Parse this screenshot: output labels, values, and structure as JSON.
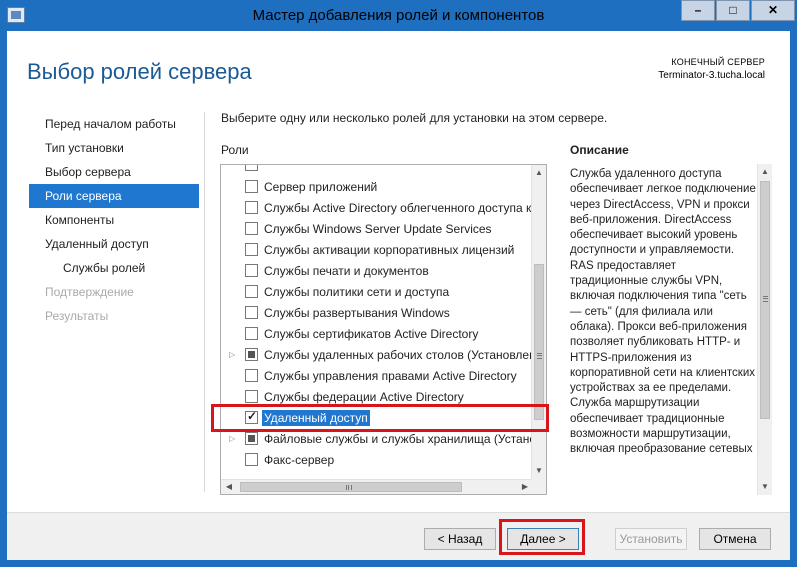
{
  "window": {
    "title": "Мастер добавления ролей и компонентов",
    "controls": {
      "minimize": "–",
      "maximize": "□",
      "close": "✕"
    }
  },
  "header": {
    "page_title": "Выбор ролей сервера",
    "destination_label": "КОНЕЧНЫЙ СЕРВЕР",
    "destination_server": "Terminator-3.tucha.local"
  },
  "nav": {
    "items": [
      {
        "label": "Перед началом работы",
        "state": "normal"
      },
      {
        "label": "Тип установки",
        "state": "normal"
      },
      {
        "label": "Выбор сервера",
        "state": "normal"
      },
      {
        "label": "Роли сервера",
        "state": "active"
      },
      {
        "label": "Компоненты",
        "state": "normal"
      },
      {
        "label": "Удаленный доступ",
        "state": "normal"
      },
      {
        "label": "Службы ролей",
        "state": "sub"
      },
      {
        "label": "Подтверждение",
        "state": "disabled"
      },
      {
        "label": "Результаты",
        "state": "disabled"
      }
    ]
  },
  "main": {
    "instruction": "Выберите одну или несколько ролей для установки на этом сервере.",
    "roles_header": "Роли",
    "description_header": "Описание",
    "roles": [
      {
        "label": "Сервер приложений",
        "state": "unchecked",
        "expandable": false
      },
      {
        "label": "Службы Active Directory облегченного доступа к",
        "state": "unchecked",
        "expandable": false
      },
      {
        "label": "Службы Windows Server Update Services",
        "state": "unchecked",
        "expandable": false
      },
      {
        "label": "Службы активации корпоративных лицензий",
        "state": "unchecked",
        "expandable": false
      },
      {
        "label": "Службы печати и документов",
        "state": "unchecked",
        "expandable": false
      },
      {
        "label": "Службы политики сети и доступа",
        "state": "unchecked",
        "expandable": false
      },
      {
        "label": "Службы развертывания Windows",
        "state": "unchecked",
        "expandable": false
      },
      {
        "label": "Службы сертификатов Active Directory",
        "state": "unchecked",
        "expandable": false
      },
      {
        "label": "Службы удаленных рабочих столов (Установлен",
        "state": "partial",
        "expandable": true
      },
      {
        "label": "Службы управления правами Active Directory",
        "state": "unchecked",
        "expandable": false
      },
      {
        "label": "Службы федерации Active Directory",
        "state": "unchecked",
        "expandable": false
      },
      {
        "label": "Удаленный доступ",
        "state": "checked",
        "expandable": false,
        "selected": true
      },
      {
        "label": "Файловые службы и службы хранилища (Устано",
        "state": "partial",
        "expandable": true
      },
      {
        "label": "Факс-сервер",
        "state": "unchecked",
        "expandable": false
      }
    ],
    "description": "Служба удаленного доступа обеспечивает легкое подключение через DirectAccess, VPN и прокси веб-приложения. DirectAccess обеспечивает высокий уровень доступности и управляемости. RAS предоставляет традиционные службы VPN, включая подключения типа \"сеть — сеть\" (для филиала или облака). Прокси веб-приложения позволяет публиковать HTTP- и HTTPS-приложения из корпоративной сети на клиентских устройствах за ее пределами. Служба маршрутизации обеспечивает традиционные возможности маршрутизации, включая преобразование сетевых"
  },
  "footer": {
    "back": "< Назад",
    "next": "Далее >",
    "install": "Установить",
    "cancel": "Отмена"
  },
  "colors": {
    "titlebar": "#1e6fbf",
    "accent": "#1f77d0",
    "heading": "#1c5a96",
    "highlight": "#d9151c"
  }
}
